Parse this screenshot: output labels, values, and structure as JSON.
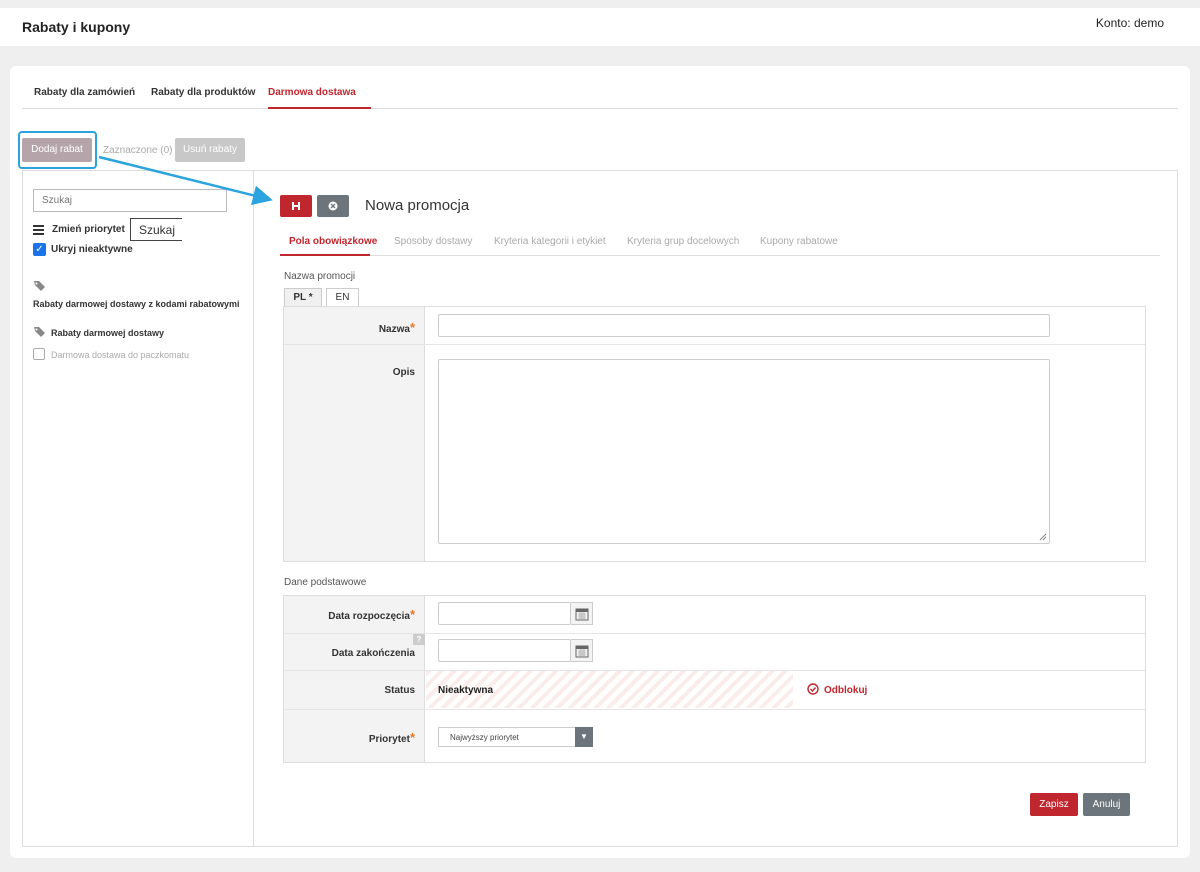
{
  "header": {
    "title": "Rabaty i kupony",
    "account_label": "Konto:",
    "account_name": "demo"
  },
  "tabs": [
    {
      "label": "Rabaty dla zamówień"
    },
    {
      "label": "Rabaty dla produktów"
    },
    {
      "label": "Darmowa dostawa",
      "active": true
    }
  ],
  "toolbar": {
    "add_label": "Dodaj rabat",
    "selected_label": "Zaznaczone (0)",
    "delete_label": "Usuń rabaty"
  },
  "sidebar": {
    "search_placeholder": "Szukaj",
    "priority_label": "Zmień priorytet",
    "tooltip": "Szukaj",
    "hide_inactive_label": "Ukryj nieaktywne",
    "group_codes": "Rabaty darmowej dostawy z kodami rabatowymi",
    "group_plain": "Rabaty darmowej dostawy",
    "items": [
      {
        "label": "Darmowa dostawa do paczkomatu"
      }
    ]
  },
  "form": {
    "title": "Nowa promocja",
    "tabs": [
      {
        "label": "Pola obowiązkowe",
        "active": true
      },
      {
        "label": "Sposoby dostawy"
      },
      {
        "label": "Kryteria kategorii i etykiet"
      },
      {
        "label": "Kryteria grup docelowych"
      },
      {
        "label": "Kupony rabatowe"
      }
    ],
    "section_name": "Nazwa promocji",
    "lang_tabs": [
      "PL *",
      "EN"
    ],
    "name_label": "Nazwa",
    "desc_label": "Opis",
    "section_basic": "Dane podstawowe",
    "start_label": "Data rozpoczęcia",
    "end_label": "Data zakończenia",
    "help": "?",
    "status_label": "Status",
    "status_value": "Nieaktywna",
    "unlock_label": "Odblokuj",
    "priority_label": "Priorytet",
    "priority_value": "Najwyższy priorytet",
    "required_mark": "*",
    "save_label": "Zapisz",
    "cancel_label": "Anuluj"
  },
  "colors": {
    "accent": "#c0262d",
    "secondary": "#6d757c",
    "highlight": "#2aa3e0"
  }
}
